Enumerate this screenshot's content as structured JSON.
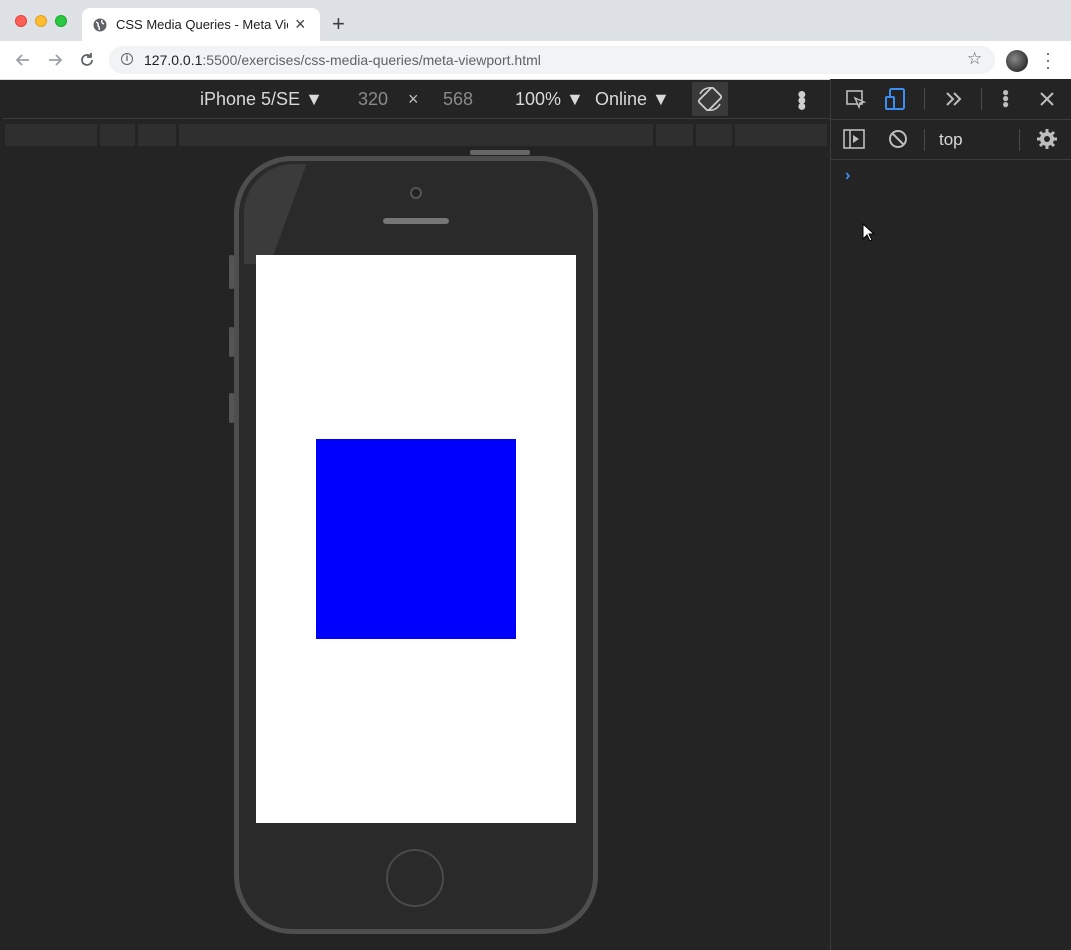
{
  "browser": {
    "tab_title": "CSS Media Queries - Meta Viev",
    "tab_close": "×",
    "new_tab": "+",
    "url_host": "127.0.0.1",
    "url_rest": ":5500/exercises/css-media-queries/meta-viewport.html"
  },
  "device_toolbar": {
    "device": "iPhone 5/SE ▼",
    "width": "320",
    "times": "×",
    "height": "568",
    "zoom": "100% ▼",
    "network": "Online ▼"
  },
  "devtools": {
    "context": "top",
    "prompt": "›"
  },
  "colors": {
    "box": "#0000ff",
    "accent": "#3b8ef3"
  },
  "icons": [
    "globe-icon",
    "back-icon",
    "forward-icon",
    "reload-icon",
    "info-icon",
    "star-icon",
    "rotate-icon",
    "inspect-icon",
    "device-toggle-icon",
    "chevrons-icon",
    "more-icon",
    "close-icon",
    "sidebar-icon",
    "clear-icon",
    "gear-icon"
  ]
}
